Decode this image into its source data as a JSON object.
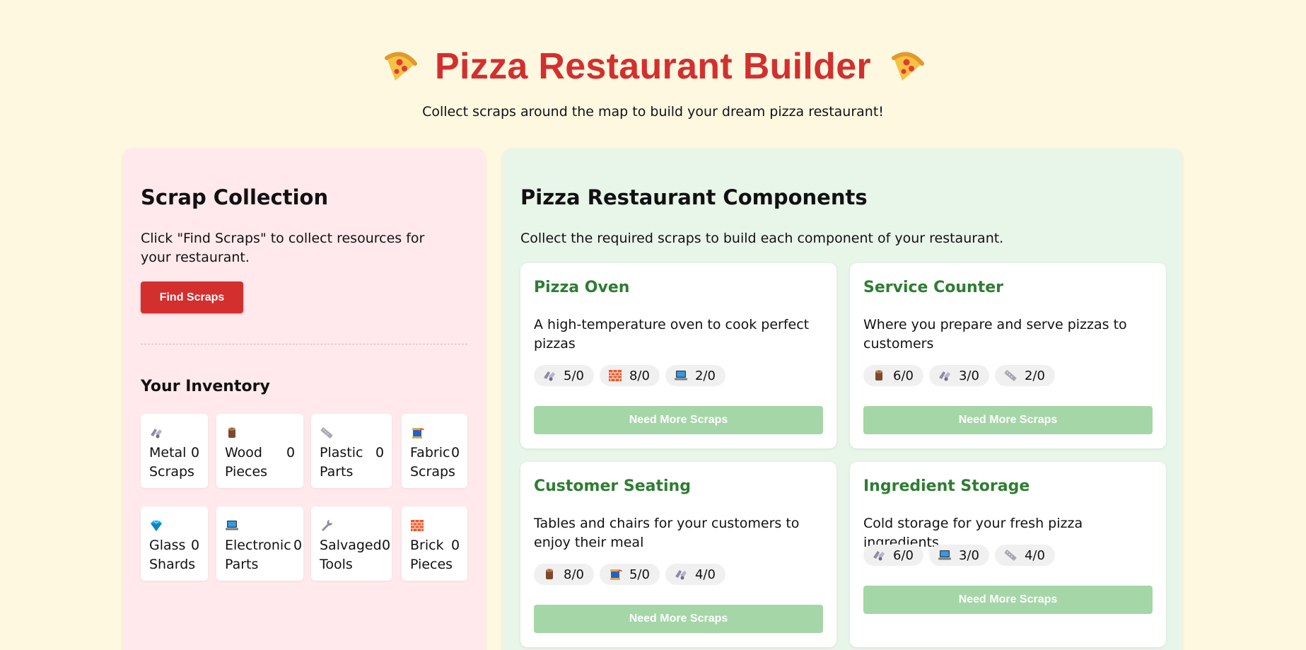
{
  "header": {
    "title": "Pizza Restaurant Builder",
    "subtitle": "Collect scraps around the map to build your dream pizza restaurant!"
  },
  "scrap_panel": {
    "title": "Scrap Collection",
    "intro": "Click \"Find Scraps\" to collect resources for your restaurant.",
    "find_button": "Find Scraps",
    "inventory_title": "Your Inventory",
    "items": [
      {
        "icon": "metal-scrap-icon",
        "name": "Metal\nScraps",
        "count": "0"
      },
      {
        "icon": "wood-log-icon",
        "name": "Wood\nPieces",
        "count": "0"
      },
      {
        "icon": "plastic-ruler-icon",
        "name": "Plastic\nParts",
        "count": "0"
      },
      {
        "icon": "fabric-spool-icon",
        "name": "Fabric\nScraps",
        "count": "0"
      },
      {
        "icon": "glass-gem-icon",
        "name": "Glass\nShards",
        "count": "0"
      },
      {
        "icon": "laptop-icon",
        "name": "Electronic\nParts",
        "count": "0"
      },
      {
        "icon": "wrench-icon",
        "name": "Salvaged\nTools",
        "count": "0"
      },
      {
        "icon": "brick-icon",
        "name": "Brick\nPieces",
        "count": "0"
      }
    ]
  },
  "components_panel": {
    "title": "Pizza Restaurant Components",
    "intro": "Collect the required scraps to build each component of your restaurant.",
    "button_label": "Need More Scraps",
    "components": [
      {
        "title": "Pizza Oven",
        "description": "A high-temperature oven to cook perfect pizzas",
        "requirements": [
          {
            "icon": "metal-scrap-icon",
            "text": "5/0"
          },
          {
            "icon": "brick-icon",
            "text": "8/0"
          },
          {
            "icon": "laptop-icon",
            "text": "2/0"
          }
        ]
      },
      {
        "title": "Service Counter",
        "description": "Where you prepare and serve pizzas to customers",
        "requirements": [
          {
            "icon": "wood-log-icon",
            "text": "6/0"
          },
          {
            "icon": "metal-scrap-icon",
            "text": "3/0"
          },
          {
            "icon": "plastic-ruler-icon",
            "text": "2/0"
          }
        ]
      },
      {
        "title": "Customer Seating",
        "description": "Tables and chairs for your customers to enjoy their meal",
        "requirements": [
          {
            "icon": "wood-log-icon",
            "text": "8/0"
          },
          {
            "icon": "fabric-spool-icon",
            "text": "5/0"
          },
          {
            "icon": "metal-scrap-icon",
            "text": "4/0"
          }
        ]
      },
      {
        "title": "Ingredient Storage",
        "description": "Cold storage for your fresh pizza ingredients",
        "requirements": [
          {
            "icon": "metal-scrap-icon",
            "text": "6/0"
          },
          {
            "icon": "laptop-icon",
            "text": "3/0"
          },
          {
            "icon": "plastic-ruler-icon",
            "text": "4/0"
          }
        ]
      }
    ]
  },
  "colors": {
    "background": "#fff8e1",
    "title_red": "#d32f2f",
    "component_green": "#2e7d32",
    "disabled_button": "#a5d6a7",
    "left_panel": "#ffe9ec",
    "right_panel": "#e8f5e9"
  }
}
